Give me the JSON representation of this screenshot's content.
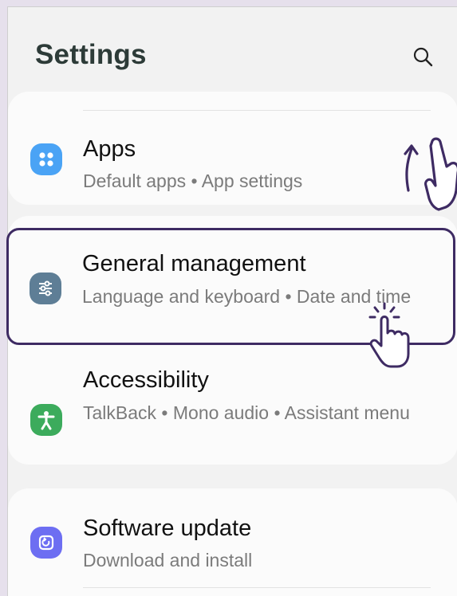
{
  "header": {
    "title": "Settings"
  },
  "icons": {
    "search": "search-icon"
  },
  "items": [
    {
      "title": "Apps",
      "subtitle": "Default apps  •  App settings",
      "icon": "apps-icon",
      "color": "#4aa3f5"
    },
    {
      "title": "General management",
      "subtitle": "Language and keyboard  •  Date and time",
      "icon": "sliders-icon",
      "color": "#5e7e96"
    },
    {
      "title": "Accessibility",
      "subtitle": "TalkBack  •  Mono audio  •  Assistant menu",
      "icon": "accessibility-icon",
      "color": "#3cab5c"
    },
    {
      "title": "Software update",
      "subtitle": "Download and install",
      "icon": "software-update-icon",
      "color": "#6d6ef2"
    }
  ],
  "annotations": {
    "swipe_gesture": "swipe-up-hand-icon",
    "tap_gesture": "tap-hand-icon",
    "stroke_color": "#3e2b63"
  }
}
